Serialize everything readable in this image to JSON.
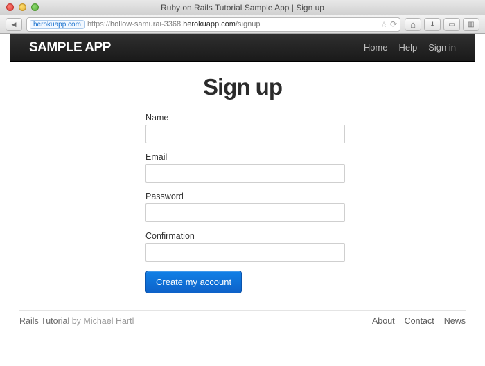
{
  "browser": {
    "windowTitle": "Ruby on Rails Tutorial Sample App | Sign up",
    "hostBadge": "herokuapp.com",
    "urlScheme": "https://",
    "urlPrefix": "hollow-samurai-3368.",
    "urlHostMain": "herokuapp.com",
    "urlPath": "/signup"
  },
  "navbar": {
    "brand": "Sample App",
    "links": {
      "home": "Home",
      "help": "Help",
      "signin": "Sign in"
    }
  },
  "page": {
    "heading": "Sign up",
    "labels": {
      "name": "Name",
      "email": "Email",
      "password": "Password",
      "confirmation": "Confirmation"
    },
    "submit": "Create my account"
  },
  "footer": {
    "title": "Rails Tutorial",
    "by": " by ",
    "author": "Michael Hartl",
    "links": {
      "about": "About",
      "contact": "Contact",
      "news": "News"
    }
  }
}
